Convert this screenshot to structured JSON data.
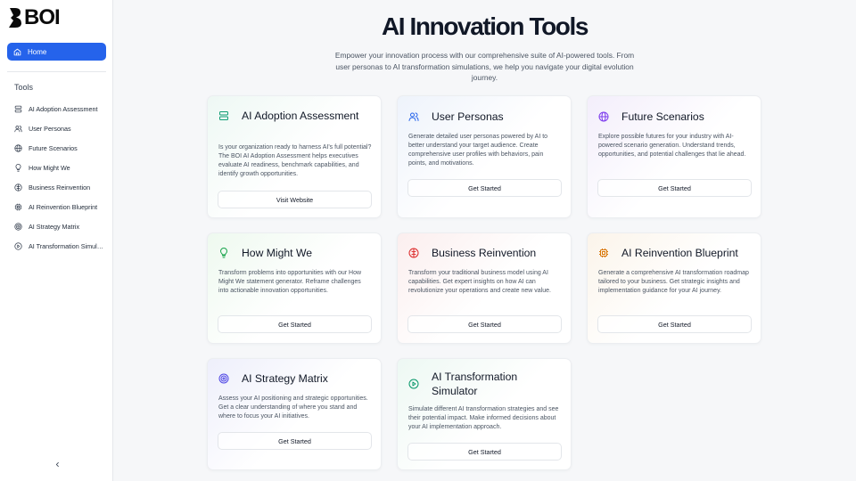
{
  "brand": {
    "logo_text": "BOI"
  },
  "sidebar": {
    "home_label": "Home",
    "tools_title": "Tools",
    "items": [
      {
        "label": "AI Adoption Assessment",
        "icon": "server-icon"
      },
      {
        "label": "User Personas",
        "icon": "users-icon"
      },
      {
        "label": "Future Scenarios",
        "icon": "globe-icon"
      },
      {
        "label": "How Might We",
        "icon": "lightbulb-icon"
      },
      {
        "label": "Business Reinvention",
        "icon": "circle-split-icon"
      },
      {
        "label": "AI Reinvention Blueprint",
        "icon": "chip-icon"
      },
      {
        "label": "AI Strategy Matrix",
        "icon": "target-icon"
      },
      {
        "label": "AI Transformation Simulator",
        "icon": "play-circle-icon"
      }
    ]
  },
  "main": {
    "title": "AI Innovation Tools",
    "subtitle": "Empower your innovation process with our comprehensive suite of AI-powered tools. From user personas to AI transformation simulations, we help you navigate your digital evolution journey.",
    "cards": [
      {
        "title": "AI Adoption Assessment",
        "description": "Is your organization ready to harness AI's full potential? The BOI AI Adoption Assessment helps executives evaluate AI readiness, benchmark capabilities, and identify growth opportunities.",
        "button": "Visit Website",
        "icon": "server-icon",
        "accent": "#0f9d74"
      },
      {
        "title": "User Personas",
        "description": "Generate detailed user personas powered by AI to better understand your target audience. Create comprehensive user profiles with behaviors, pain points, and motivations.",
        "button": "Get Started",
        "icon": "users-icon",
        "accent": "#2563eb"
      },
      {
        "title": "Future Scenarios",
        "description": "Explore possible futures for your industry with AI-powered scenario generation. Understand trends, opportunities, and potential challenges that lie ahead.",
        "button": "Get Started",
        "icon": "globe-icon",
        "accent": "#7c3aed"
      },
      {
        "title": "How Might We",
        "description": "Transform problems into opportunities with our How Might We statement generator. Reframe challenges into actionable innovation opportunities.",
        "button": "Get Started",
        "icon": "lightbulb-icon",
        "accent": "#16a34a"
      },
      {
        "title": "Business Reinvention",
        "description": "Transform your traditional business model using AI capabilities. Get expert insights on how AI can revolutionize your operations and create new value.",
        "button": "Get Started",
        "icon": "circle-split-icon",
        "accent": "#dc2626"
      },
      {
        "title": "AI Reinvention Blueprint",
        "description": "Generate a comprehensive AI transformation roadmap tailored to your business. Get strategic insights and implementation guidance for your AI journey.",
        "button": "Get Started",
        "icon": "chip-icon",
        "accent": "#d97706"
      },
      {
        "title": "AI Strategy Matrix",
        "description": "Assess your AI positioning and strategic opportunities. Get a clear understanding of where you stand and where to focus your AI initiatives.",
        "button": "Get Started",
        "icon": "target-icon",
        "accent": "#4f46e5"
      },
      {
        "title": "AI Transformation Simulator",
        "description": "Simulate different AI transformation strategies and see their potential impact. Make informed decisions about your AI implementation approach.",
        "button": "Get Started",
        "icon": "play-circle-icon",
        "accent": "#059669"
      }
    ]
  }
}
